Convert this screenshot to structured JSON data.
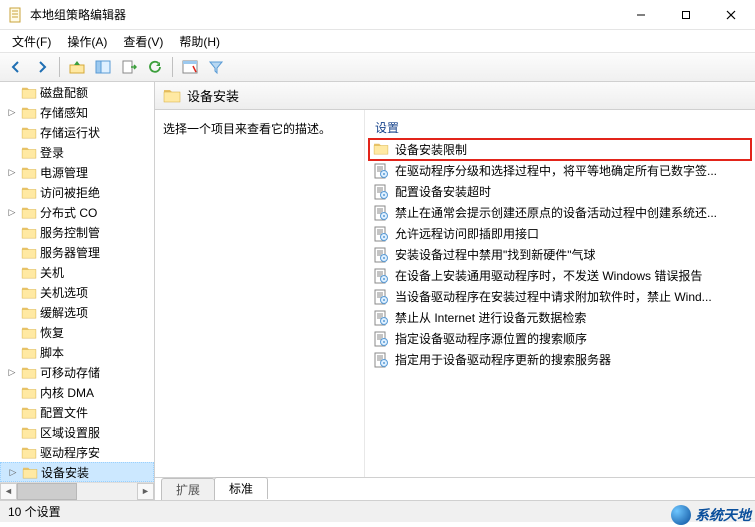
{
  "window": {
    "title": "本地组策略编辑器"
  },
  "menu": {
    "file": "文件(F)",
    "action": "操作(A)",
    "view": "查看(V)",
    "help": "帮助(H)"
  },
  "tree": {
    "items": [
      {
        "label": "磁盘配额",
        "expandable": false
      },
      {
        "label": "存储感知",
        "expandable": true
      },
      {
        "label": "存储运行状",
        "expandable": false
      },
      {
        "label": "登录",
        "expandable": false
      },
      {
        "label": "电源管理",
        "expandable": true
      },
      {
        "label": "访问被拒绝",
        "expandable": false
      },
      {
        "label": "分布式 CO",
        "expandable": true
      },
      {
        "label": "服务控制管",
        "expandable": false
      },
      {
        "label": "服务器管理",
        "expandable": false
      },
      {
        "label": "关机",
        "expandable": false
      },
      {
        "label": "关机选项",
        "expandable": false
      },
      {
        "label": "缓解选项",
        "expandable": false
      },
      {
        "label": "恢复",
        "expandable": false
      },
      {
        "label": "脚本",
        "expandable": false
      },
      {
        "label": "可移动存储",
        "expandable": true
      },
      {
        "label": "内核 DMA",
        "expandable": false
      },
      {
        "label": "配置文件",
        "expandable": false
      },
      {
        "label": "区域设置服",
        "expandable": false
      },
      {
        "label": "驱动程序安",
        "expandable": false
      },
      {
        "label": "设备安装",
        "expandable": true,
        "selected": true
      }
    ]
  },
  "detail": {
    "header": "设备安装",
    "description_prompt": "选择一个项目来查看它的描述。",
    "column_header": "设置",
    "items": [
      {
        "type": "folder",
        "label": "设备安装限制",
        "highlighted": true
      },
      {
        "type": "policy",
        "label": "在驱动程序分级和选择过程中，将平等地确定所有已数字签..."
      },
      {
        "type": "policy",
        "label": "配置设备安装超时"
      },
      {
        "type": "policy",
        "label": "禁止在通常会提示创建还原点的设备活动过程中创建系统还..."
      },
      {
        "type": "policy",
        "label": "允许远程访问即插即用接口"
      },
      {
        "type": "policy",
        "label": "安装设备过程中禁用\"找到新硬件\"气球"
      },
      {
        "type": "policy",
        "label": "在设备上安装通用驱动程序时，不发送 Windows 错误报告"
      },
      {
        "type": "policy",
        "label": "当设备驱动程序在安装过程中请求附加软件时，禁止 Wind..."
      },
      {
        "type": "policy",
        "label": "禁止从 Internet 进行设备元数据检索"
      },
      {
        "type": "policy",
        "label": "指定设备驱动程序源位置的搜索顺序"
      },
      {
        "type": "policy",
        "label": "指定用于设备驱动程序更新的搜索服务器"
      }
    ]
  },
  "tabs": {
    "extended": "扩展",
    "standard": "标准"
  },
  "status": {
    "text": "10 个设置"
  },
  "watermark": {
    "text": "系统天地"
  }
}
